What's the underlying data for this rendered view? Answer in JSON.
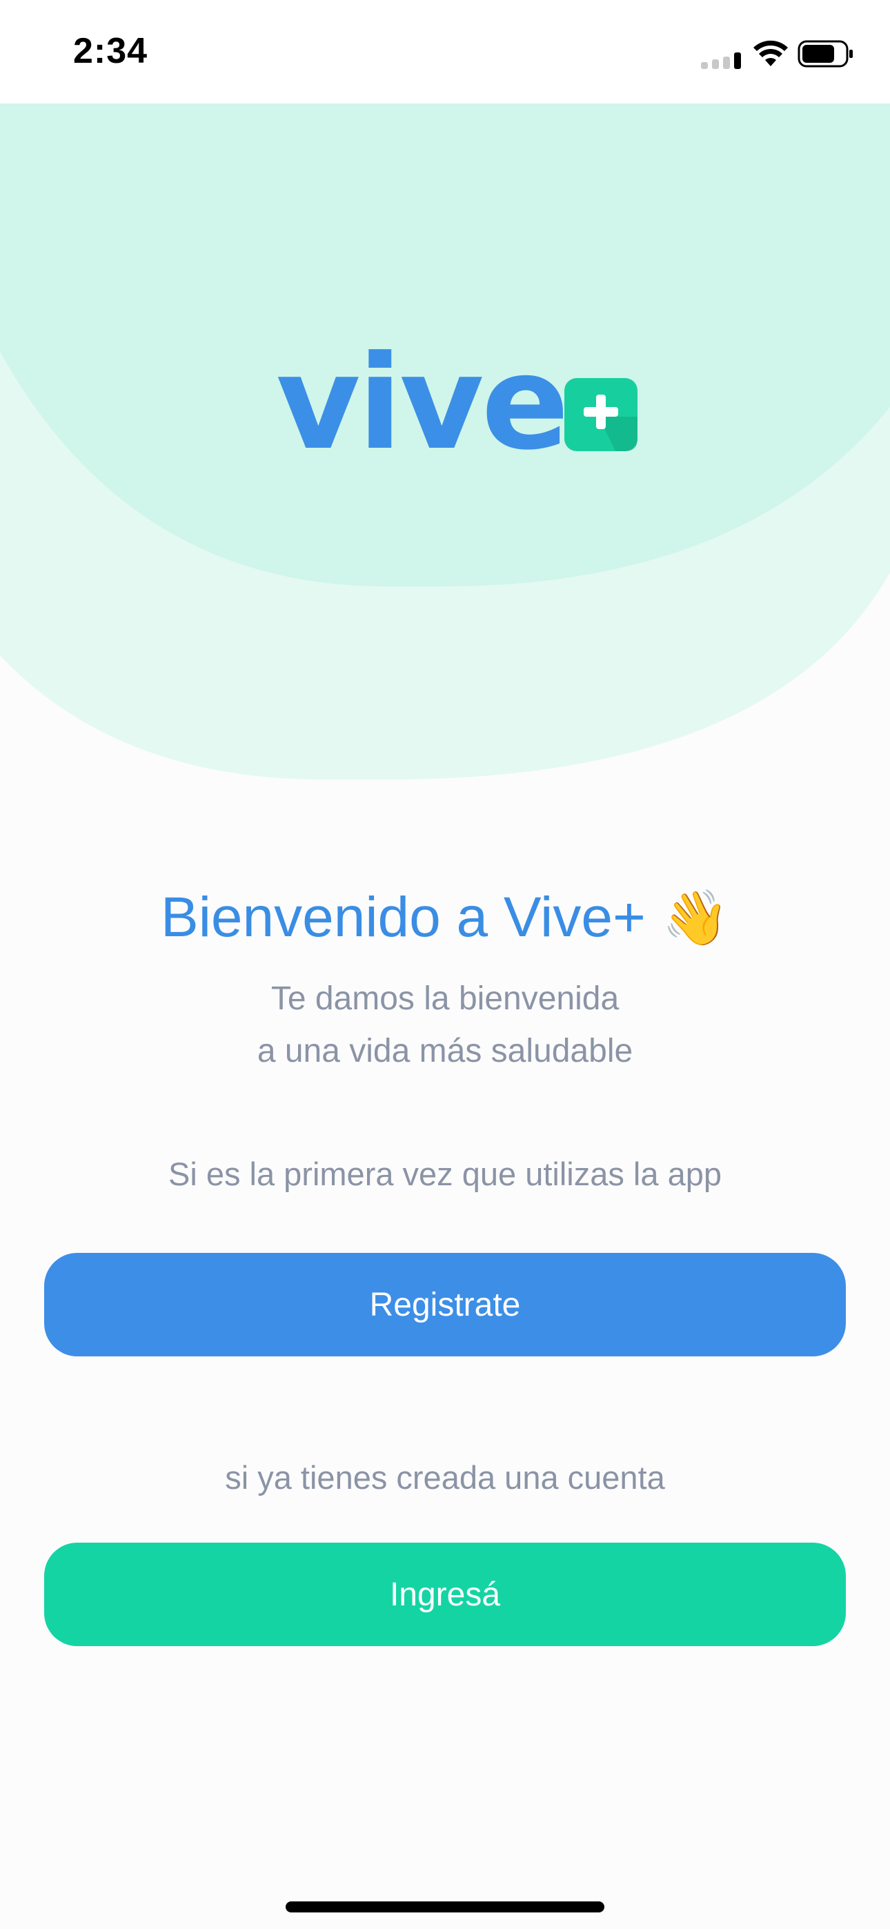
{
  "status_bar": {
    "time": "2:34"
  },
  "logo": {
    "word": "vive",
    "plus_symbol": "+"
  },
  "welcome": {
    "title": "Bienvenido a Vive+",
    "emoji": "👋",
    "subtitle_line1": "Te damos la bienvenida",
    "subtitle_line2": "a una vida más saludable"
  },
  "register": {
    "hint": "Si es la primera vez que utilizas la app",
    "button_label": "Registrate"
  },
  "login": {
    "hint": "si ya tienes creada una cuenta",
    "button_label": "Ingresá"
  },
  "colors": {
    "primary_blue": "#3d8ee6",
    "accent_green": "#14d4a4",
    "header_mint": "#d0f5ea",
    "header_mint_light": "#e4f9f2",
    "text_muted": "#8b93a6"
  },
  "icons": [
    "signal-icon",
    "wifi-icon",
    "battery-icon",
    "plus-icon"
  ]
}
